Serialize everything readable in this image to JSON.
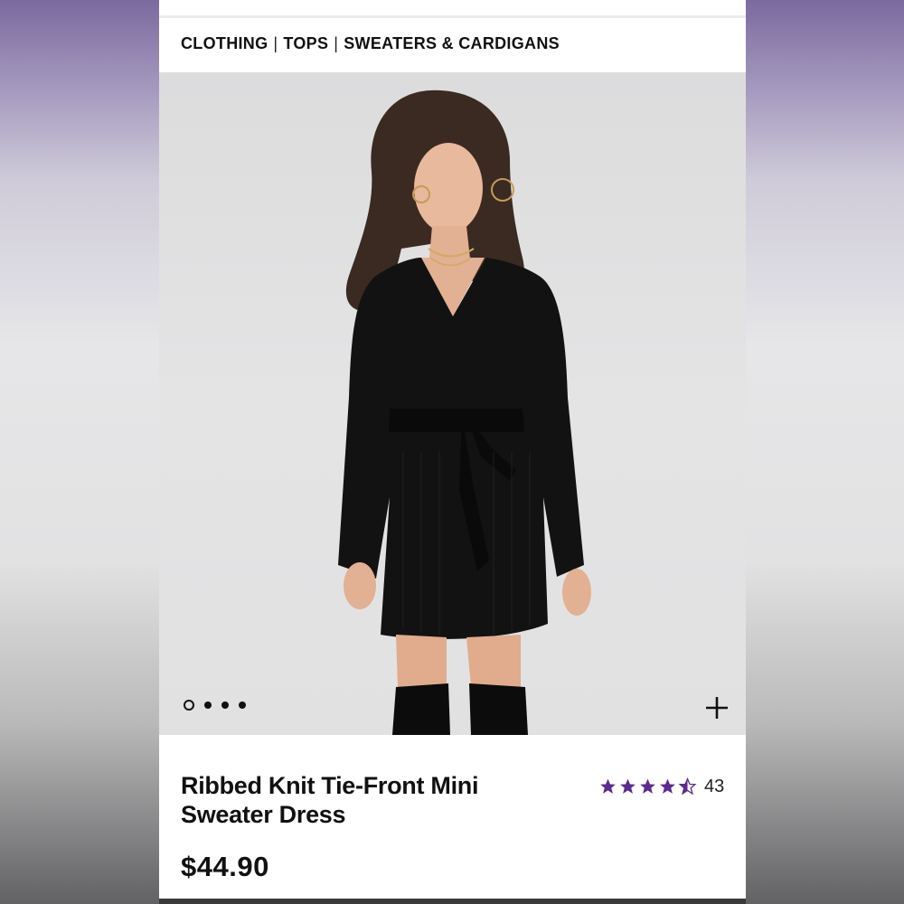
{
  "breadcrumb": {
    "items": [
      "CLOTHING",
      "TOPS",
      "SWEATERS & CARDIGANS"
    ],
    "separator": "|"
  },
  "gallery": {
    "image_count": 4,
    "active_index": 0,
    "zoom_icon": "plus-icon"
  },
  "product": {
    "title": "Ribbed Knit Tie-Front Mini Sweater Dress",
    "price": "$44.90",
    "rating": 4.5,
    "review_count": "43",
    "star_color": "#5b2c8f"
  },
  "colors": {
    "text": "#111111",
    "hero_background": "#e1e1e2",
    "accent": "#5b2c8f"
  }
}
